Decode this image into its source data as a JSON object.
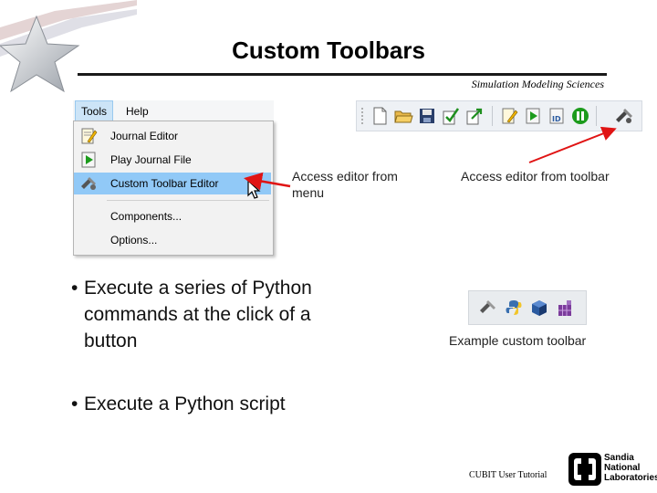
{
  "header": {
    "title": "Custom Toolbars",
    "subtitle": "Simulation Modeling Sciences"
  },
  "menu_screenshot": {
    "menubar": [
      "Tools",
      "Help"
    ],
    "items": [
      {
        "label": "Journal Editor",
        "icon": "journal-editor-icon",
        "highlighted": false
      },
      {
        "label": "Play Journal File",
        "icon": "play-icon",
        "highlighted": false
      },
      {
        "label": "Custom Toolbar Editor",
        "icon": "toolbar-editor-icon",
        "highlighted": true
      },
      {
        "label": "Components...",
        "icon": "",
        "highlighted": false
      },
      {
        "label": "Options...",
        "icon": "",
        "highlighted": false
      }
    ]
  },
  "toolbar_icons": [
    "new-file-icon",
    "open-folder-icon",
    "save-icon",
    "checkmark-icon",
    "export-icon",
    "journal-editor-icon",
    "play-icon",
    "id-icon",
    "pause-icon",
    "toolbar-editor-icon"
  ],
  "captions": {
    "menu": "Access editor from menu",
    "toolbar": "Access editor from toolbar",
    "example": "Example custom toolbar"
  },
  "bullets": [
    "Execute a series of Python commands at the click of a button",
    "Execute a Python script"
  ],
  "example_toolbar_icons": [
    "tool-editor-icon",
    "python-icon",
    "cube-icon",
    "mesh-icon"
  ],
  "footer": {
    "text": "CUBIT User Tutorial",
    "logo_lines": [
      "Sandia",
      "National",
      "Laboratories"
    ]
  },
  "colors": {
    "highlight": "#91c9f7",
    "arrow": "#e01414",
    "title_rule": "#1a1a1a"
  }
}
